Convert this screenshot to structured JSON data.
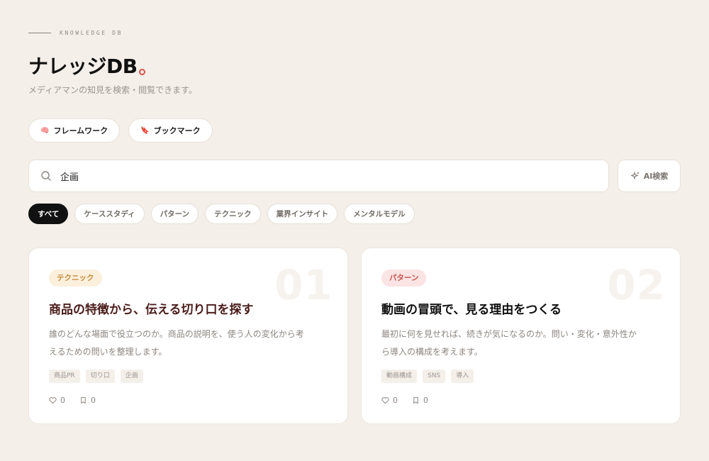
{
  "header": {
    "eyebrow": "KNOWLEDGE DB",
    "title": "ナレッジDB",
    "subtitle": "メディアマンの知見を検索・閲覧できます。"
  },
  "quick_links": [
    {
      "icon": "🧠",
      "label": "フレームワーク"
    },
    {
      "icon": "🔖",
      "label": "ブックマーク"
    }
  ],
  "search": {
    "value": "企画",
    "ai_label": "AI検索"
  },
  "filters": [
    "すべて",
    "ケーススタディ",
    "パターン",
    "テクニック",
    "業界インサイト",
    "メンタルモデル"
  ],
  "cards": [
    {
      "number": "01",
      "category": "テクニック",
      "title": "商品の特徴から、伝える切り口を探す",
      "desc_line1": "誰のどんな場面で役立つのか。商品の説明を、使う人の変化から考",
      "desc_line2": "えるための問いを整理します。",
      "tags": [
        "商品PR",
        "切り口",
        "企画"
      ],
      "likes": "0",
      "bookmarks": "0"
    },
    {
      "number": "02",
      "category": "パターン",
      "title": "動画の冒頭で、見る理由をつくる",
      "desc_line1": "最初に何を見せれば、続きが気になるのか。問い・変化・意外性か",
      "desc_line2": "ら導入の構成を考えます。",
      "tags": [
        "動画構成",
        "SNS",
        "導入"
      ],
      "likes": "0",
      "bookmarks": "0"
    }
  ],
  "colors": {
    "accent": "#d2544c",
    "background": "#f4efe8",
    "active_chip": "#111111"
  }
}
